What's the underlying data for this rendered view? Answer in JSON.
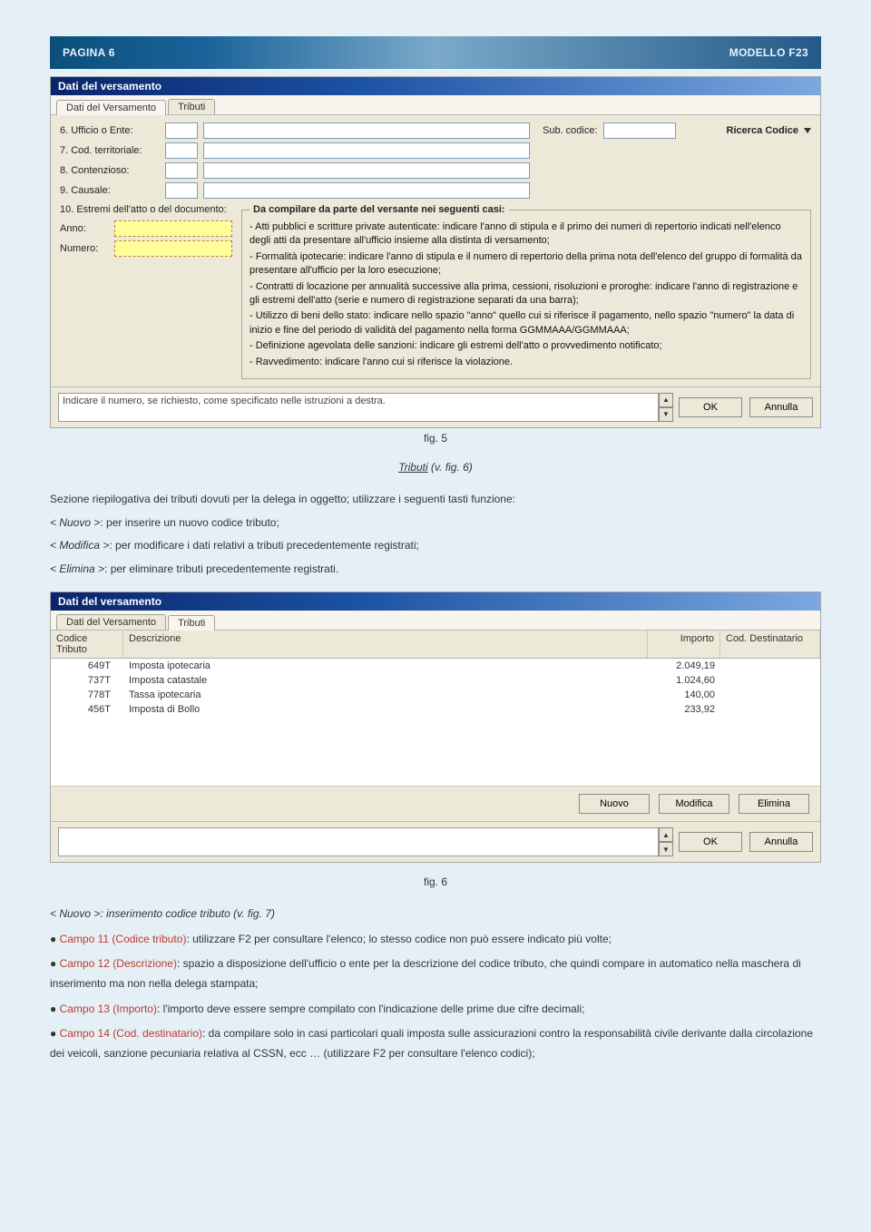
{
  "header": {
    "left": "PAGINA 6",
    "right": "MODELLO F23"
  },
  "fig5": {
    "title": "Dati del versamento",
    "tabs": {
      "active": "Dati del Versamento",
      "other": "Tributi"
    },
    "labels": {
      "l6": "6. Ufficio o Ente:",
      "l7": "7. Cod. territoriale:",
      "l8": "8. Contenzioso:",
      "l9": "9. Causale:",
      "sub": "Sub. codice:",
      "ricerca": "Ricerca Codice",
      "l10": "10. Estremi dell'atto o del documento:",
      "anno": "Anno:",
      "numero": "Numero:"
    },
    "fs_legend": "Da compilare da parte del versante nei seguenti casi:",
    "help": [
      "- Atti pubblici e scritture private autenticate: indicare l'anno di stipula e il primo dei numeri di repertorio indicati nell'elenco degli atti da presentare all'ufficio insieme alla distinta di versamento;",
      "- Formalità ipotecarie: indicare l'anno di stipula e il numero di repertorio della prima nota dell'elenco del gruppo di formalità da presentare all'ufficio per la loro esecuzione;",
      "- Contratti di locazione  per annualità successive alla prima, cessioni, risoluzioni e proroghe: indicare l'anno di registrazione e gli estremi dell'atto (serie e numero di registrazione separati da una barra);",
      "- Utilizzo di beni dello stato: indicare nello spazio \"anno\" quello cui si riferisce il pagamento, nello spazio \"numero\" la data di inizio e fine del periodo di validità del pagamento nella forma GGMMAAA/GGMMAAA;",
      "- Definizione agevolata delle sanzioni: indicare gli estremi dell'atto o provvedimento notificato;",
      "- Ravvedimento: indicare l'anno cui si riferisce la violazione."
    ],
    "note_placeholder": "Indicare il numero, se richiesto, come specificato nelle istruzioni a destra.",
    "ok": "OK",
    "annulla": "Annulla",
    "caption": "fig. 5"
  },
  "section_tributi": {
    "title_u": "Tributi",
    "title_rest": "  (v. fig. 6)",
    "intro": "Sezione riepilogativa dei tributi dovuti per la delega in oggetto; utilizzare i seguenti tasti funzione:",
    "r1a": "< Nuovo >",
    "r1b": ":     per inserire un nuovo codice tributo;",
    "r2a": "< Modifica >",
    "r2b": ": per modificare i dati relativi a tributi precedentemente registrati;",
    "r3a": "< Elimina >",
    "r3b": ":  per eliminare tributi precedentemente registrati."
  },
  "fig6": {
    "title": "Dati del versamento",
    "tabs": {
      "other": "Dati del Versamento",
      "active": "Tributi"
    },
    "cols": {
      "c1": "Codice Tributo",
      "c2": "Descrizione",
      "c3": "Importo",
      "c4": "Cod. Destinatario"
    },
    "rows": [
      {
        "code": "649T",
        "desc": "Imposta ipotecaria",
        "imp": "2.049,19",
        "dest": ""
      },
      {
        "code": "737T",
        "desc": "Imposta catastale",
        "imp": "1.024,60",
        "dest": ""
      },
      {
        "code": "778T",
        "desc": "Tassa ipotecaria",
        "imp": "140,00",
        "dest": ""
      },
      {
        "code": "456T",
        "desc": "Imposta di Bollo",
        "imp": "233,92",
        "dest": ""
      }
    ],
    "btn_nuovo": "Nuovo",
    "btn_mod": "Modifica",
    "btn_del": "Elimina",
    "ok": "OK",
    "annulla": "Annulla",
    "caption": "fig. 6"
  },
  "fig7_intro": {
    "title_a": "< Nuovo >",
    "title_b": ":     inserimento codice tributo  (v. fig. 7)",
    "b1_label": "Campo 11 (Codice tributo)",
    "b1_txt": ": utilizzare F2 per consultare l'elenco; lo stesso codice non può essere indicato più volte;",
    "b2_label": "Campo 12 (Descrizione)",
    "b2_txt": ": spazio a disposizione dell'ufficio o ente per la descrizione del codice tributo, che quindi compare in automatico nella maschera di inserimento ma non nella delega stampata;",
    "b3_label": "Campo 13 (Importo)",
    "b3_txt": ": l'importo deve essere sempre compilato con l'indicazione delle prime due cifre decimali;",
    "b4_label": "Campo 14 (Cod. destinatario)",
    "b4_txt": ": da compilare solo in casi particolari quali imposta sulle assicurazioni contro la responsabilità civile derivante dalla circolazione dei veicoli, sanzione pecuniaria relativa al CSSN, ecc … (utilizzare F2 per consultare l'elenco codici);"
  }
}
